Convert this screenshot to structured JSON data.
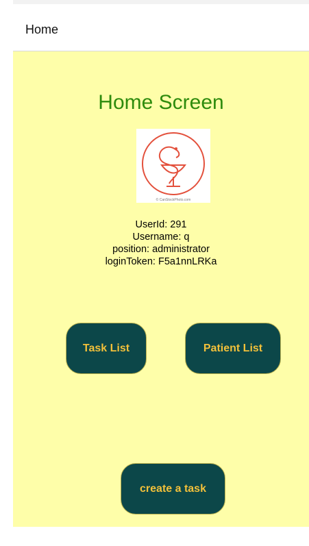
{
  "header": {
    "title": "Home"
  },
  "main": {
    "title": "Home Screen",
    "logo": {
      "caption": "© CanStockPhoto.com"
    },
    "user_info": {
      "user_id": "UserId: 291",
      "username": "Username: q",
      "position": "position: administrator",
      "login_token": "loginToken: F5a1nnLRKa"
    },
    "buttons": {
      "task_list": "Task List",
      "patient_list": "Patient List",
      "create_task": "create a task"
    }
  },
  "colors": {
    "background": "#fefea9",
    "title": "#2e8b0d",
    "button_bg": "#0c4749",
    "button_text": "#f2c03a",
    "logo_stroke": "#e3503c"
  }
}
